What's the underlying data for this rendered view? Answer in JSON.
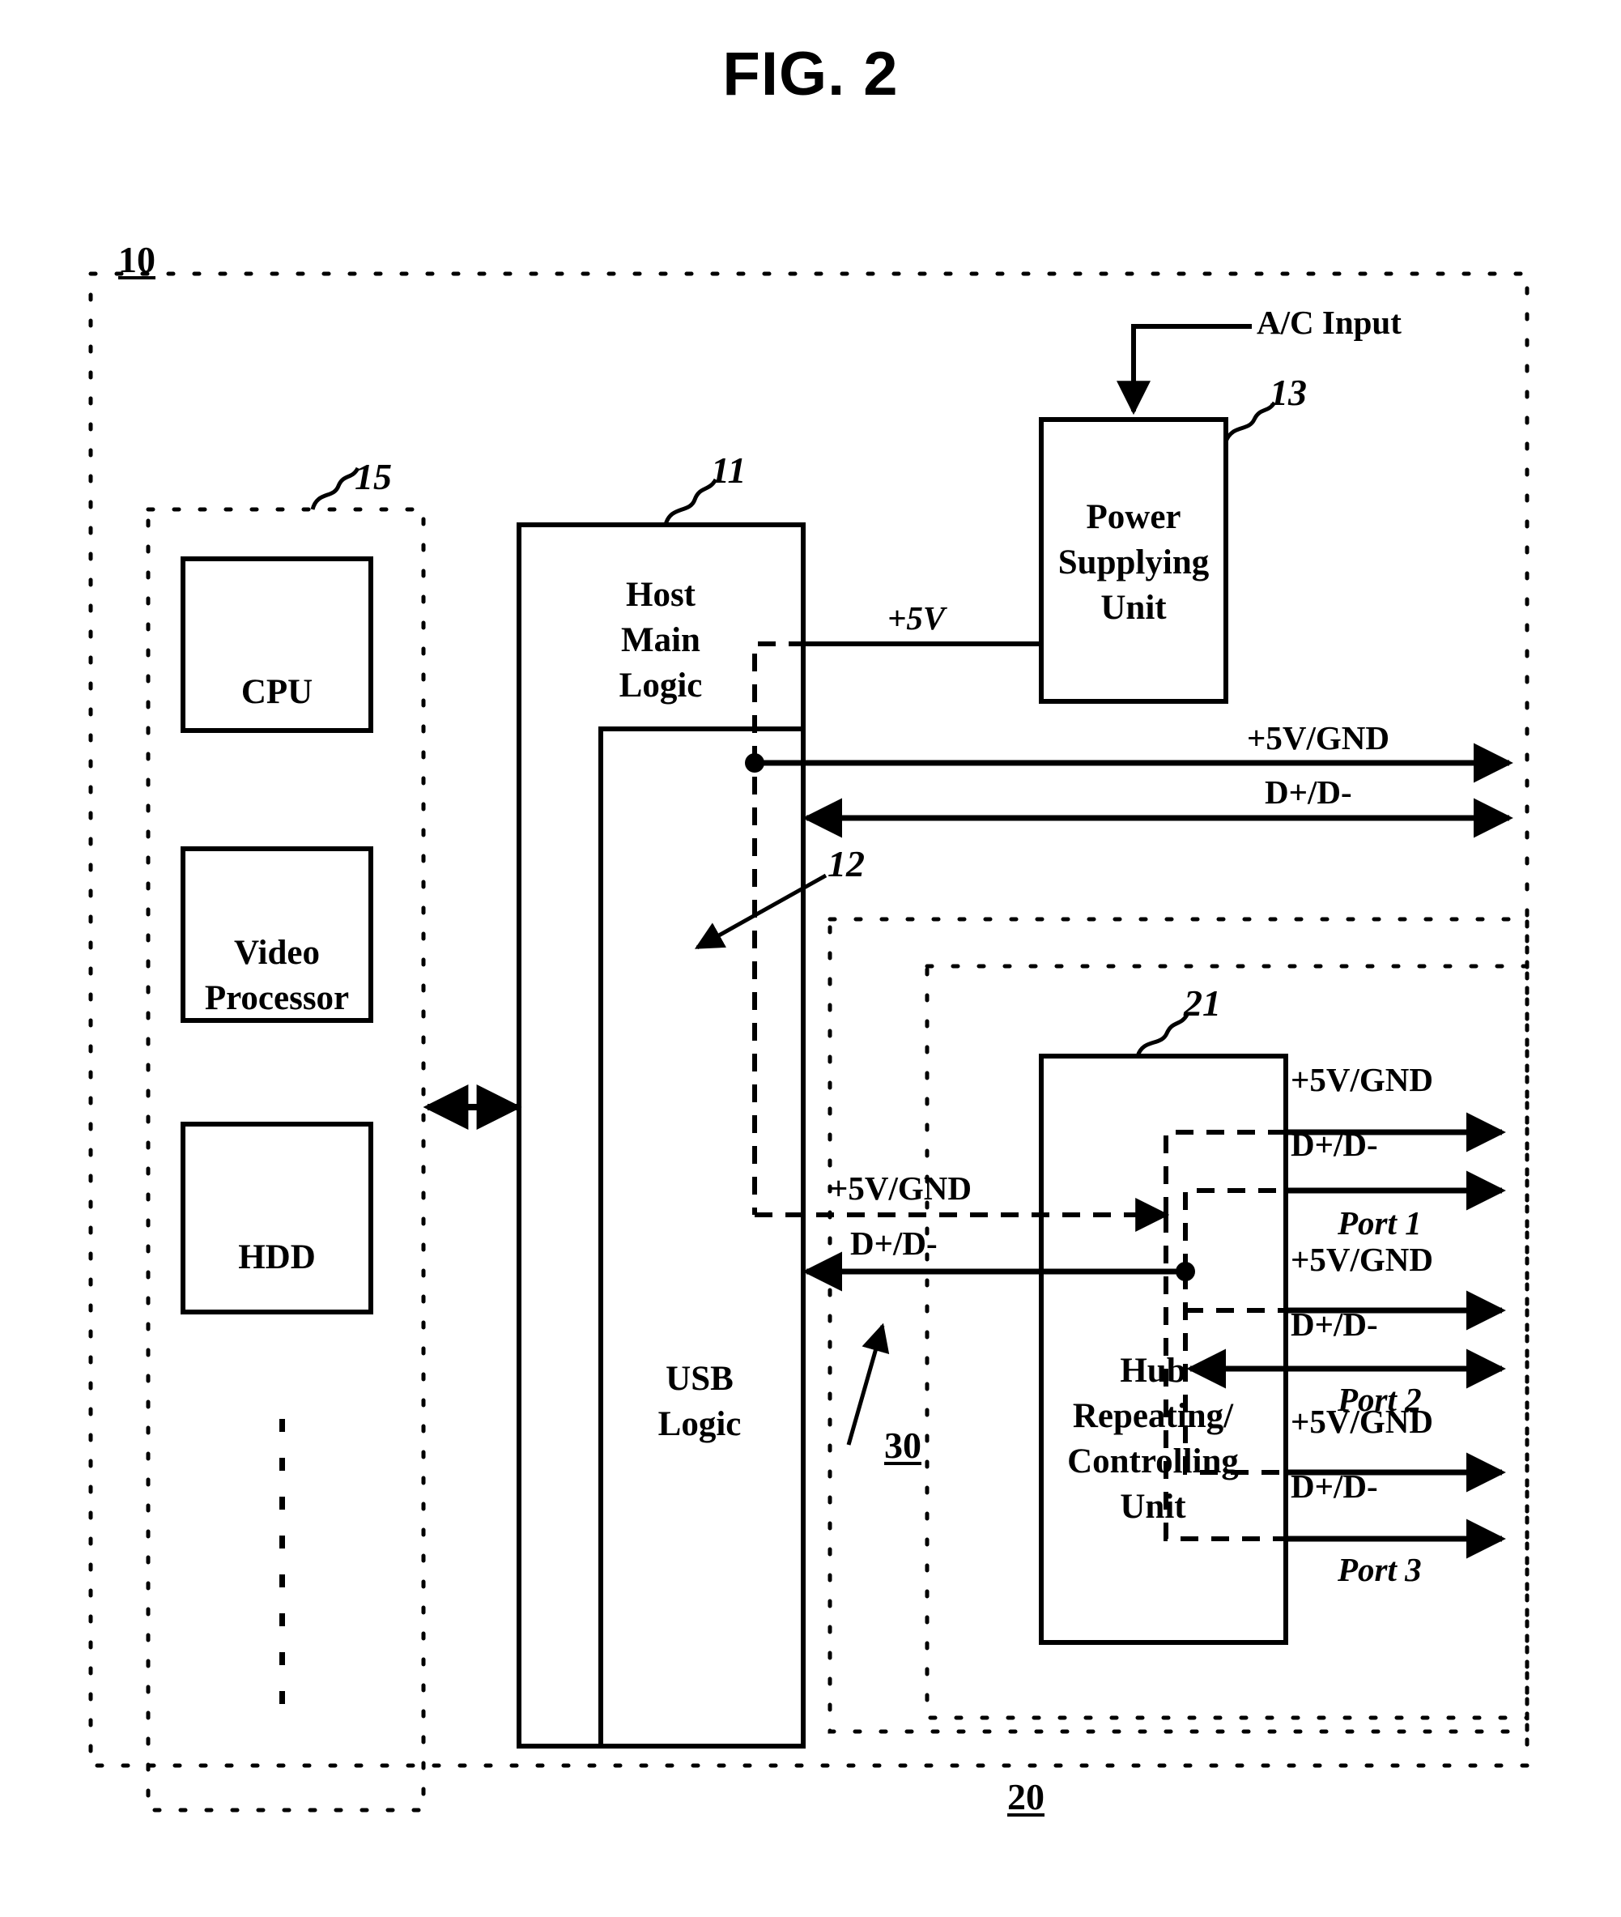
{
  "figure": {
    "title": "FIG. 2",
    "reference_numerals": {
      "host_system": "10",
      "host_main_logic": "11",
      "usb_logic": "12",
      "power_supplying_unit": "13",
      "core_subsystem": "15",
      "hub_device": "20",
      "hub_repeating_controlling_unit": "21",
      "interconnect_cable": "30"
    }
  },
  "blocks": {
    "cpu": "CPU",
    "video_processor": "Video\nProcessor",
    "video_processor_line1": "Video",
    "video_processor_line2": "Processor",
    "hdd": "HDD",
    "host_main_logic_line1": "Host",
    "host_main_logic_line2": "Main",
    "host_main_logic_line3": "Logic",
    "usb_logic_line1": "USB",
    "usb_logic_line2": "Logic",
    "power_supplying_unit_line1": "Power",
    "power_supplying_unit_line2": "Supplying",
    "power_supplying_unit_line3": "Unit",
    "hub_unit_line1": "Hub",
    "hub_unit_line2": "Repeating/",
    "hub_unit_line3": "Controlling",
    "hub_unit_line4": "Unit"
  },
  "signals": {
    "ac_input": "A/C Input",
    "plus_5v": "+5V",
    "host_power_bus": "+5V/GND",
    "host_data_bus": "D+/D-",
    "cable_power": "+5V/GND",
    "cable_data": "D+/D-",
    "port1_power": "+5V/GND",
    "port1_data": "D+/D-",
    "port2_power": "+5V/GND",
    "port2_data": "D+/D-",
    "port3_power": "+5V/GND",
    "port3_data": "D+/D-"
  },
  "ports": {
    "port1": "Port 1",
    "port2": "Port 2",
    "port3": "Port 3"
  },
  "colors": {
    "ink": "#000000",
    "paper": "#ffffff"
  }
}
